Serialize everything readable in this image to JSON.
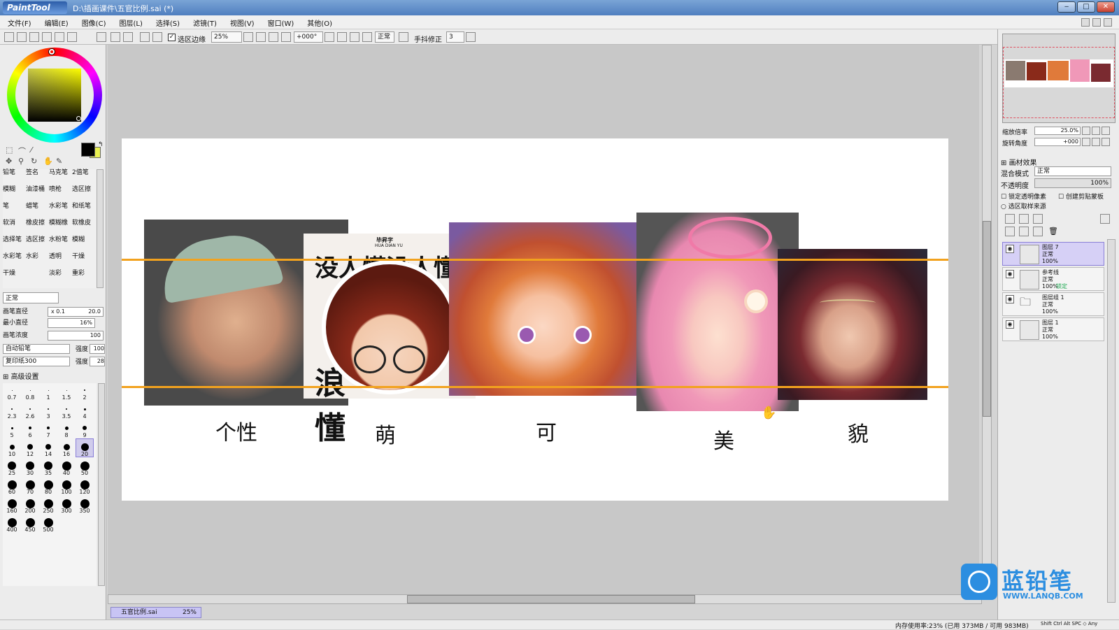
{
  "window": {
    "app_logo": "PaintTool SAI",
    "title": "D:\\插画课件\\五官比例.sai (*)",
    "controls": [
      "‒",
      "□",
      "✕"
    ]
  },
  "menu": [
    "文件(F)",
    "编辑(E)",
    "图像(C)",
    "图层(L)",
    "选择(S)",
    "滤镜(T)",
    "视图(V)",
    "窗口(W)",
    "其他(O)"
  ],
  "toolbar": {
    "selection_edge_label": "选区边缘",
    "zoom_value": "25%",
    "rotation_value": "+000°",
    "blend_label": "正常",
    "stabilizer_label": "手抖修正",
    "stabilizer_value": "3"
  },
  "brushes": [
    [
      "铅笔",
      "签名",
      "马克笔",
      "2值笔"
    ],
    [
      "模糊",
      "油漆桶",
      "喷枪",
      "选区擦"
    ],
    [
      "笔",
      "蜡笔",
      "水彩笔",
      "和纸笔"
    ],
    [
      "软消",
      "橡皮擦",
      "模糊橡",
      "软橡皮"
    ],
    [
      "选择笔",
      "选区擦",
      "水粉笔",
      "模糊"
    ],
    [
      "水彩笔",
      "水彩",
      "透明",
      "干燥"
    ],
    [
      "干燥",
      "",
      "淡彩",
      "重彩"
    ]
  ],
  "brush_settings": {
    "mode": "正常",
    "size_label": "画笔直径",
    "size_mult": "x 0.1",
    "size_value": "20.0",
    "min_size_label": "最小直径",
    "min_size_value": "16%",
    "density_label": "画笔浓度",
    "density_value": "100",
    "shape_preset": "自动铅笔",
    "shape_strength_label": "强度",
    "shape_strength_value": "100",
    "texture_preset": "复印纸300",
    "texture_strength_label": "强度",
    "texture_strength_value": "28",
    "advanced_label": "高级设置"
  },
  "brush_sizes": [
    "0.7",
    "0.8",
    "1",
    "1.5",
    "2",
    "2.3",
    "2.6",
    "3",
    "3.5",
    "4",
    "5",
    "6",
    "7",
    "8",
    "9",
    "10",
    "12",
    "14",
    "16",
    "20",
    "25",
    "30",
    "35",
    "40",
    "50",
    "60",
    "70",
    "80",
    "100",
    "120",
    "160",
    "200",
    "250",
    "300",
    "350",
    "400",
    "450",
    "500"
  ],
  "canvas": {
    "labels": [
      "个性",
      "萌",
      "可",
      "美",
      "貌"
    ],
    "poster_header": "毕昇字",
    "poster_sub": "HUA DIAN YU",
    "poster_text_top": "没人懂没人懂",
    "poster_text_bottom": "浪懂"
  },
  "navigator": {
    "zoom_label": "缩放倍率",
    "zoom_value": "25.0%",
    "angle_label": "旋转角度",
    "angle_value": "+000"
  },
  "layer_props": {
    "texture_label": "画材效果",
    "blend_label": "混合模式",
    "blend_value": "正常",
    "opacity_label": "不透明度",
    "opacity_value": "100%",
    "lock_alpha": "锁定透明像素",
    "clipping": "创建剪贴蒙板",
    "sample_source": "选区取样来源"
  },
  "layers": [
    {
      "name": "图层 7",
      "mode": "正常",
      "opacity": "100%",
      "extra": ""
    },
    {
      "name": "参考线",
      "mode": "正常",
      "opacity": "100%",
      "extra": "锁定"
    },
    {
      "name": "图层组 1",
      "mode": "正常",
      "opacity": "100%",
      "extra": ""
    },
    {
      "name": "图层 1",
      "mode": "正常",
      "opacity": "100%",
      "extra": ""
    }
  ],
  "tab": {
    "name": "五官比例.sai",
    "zoom": "25%"
  },
  "status": {
    "memory": "内存使用率:23% (已用 373MB / 可用 983MB)",
    "keys": "Shift Ctrl Alt SPC ◇ Any"
  },
  "watermark": {
    "name": "蓝铅笔",
    "url": "WWW.LANQB.COM"
  },
  "colors": {
    "accent_highlight": "#f2a21e",
    "selection": "#d6d0f6",
    "watermark_blue": "#2c8ee0"
  }
}
